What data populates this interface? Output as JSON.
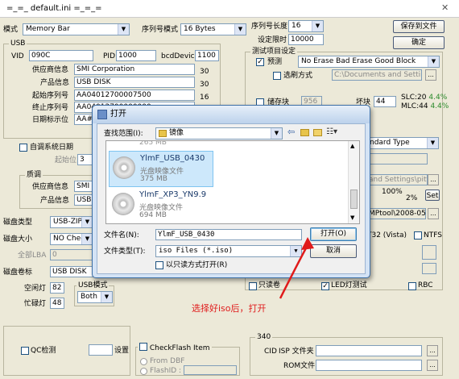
{
  "window": {
    "title": "=_=_   default.ini   =_=_=",
    "close_glyph": "✕"
  },
  "mode": {
    "label": "模式",
    "value": "Memory Bar"
  },
  "serial_mode": {
    "label": "序列号模式",
    "value": "16 Bytes"
  },
  "serial_length": {
    "label": "序列号长度",
    "value": "16"
  },
  "set_limit": {
    "label": "设定限时",
    "value": "10000"
  },
  "buttons": {
    "save": "保存到文件",
    "ok": "确定",
    "set": "Set"
  },
  "usb": {
    "group": "USB",
    "vid_label": "VID",
    "vid": "090C",
    "pid_label": "PID",
    "pid": "1000",
    "bcd_label": "bcdDevice",
    "bcd": "1100",
    "vendor_label": "供应商信息",
    "vendor": "SMI Corporation",
    "vendor_len": "30",
    "product_label": "产品信息",
    "product": "USB DISK",
    "product_len": "30",
    "start_sn_label": "起始序列号",
    "start_sn": "AA04012700007500",
    "start_sn_len": "16",
    "end_sn_label": "终止序列号",
    "end_sn": "AA04012700000000",
    "date_label": "日期标示位",
    "date": "AA##"
  },
  "auto_date": {
    "label": "自调系统日期",
    "start_label": "起始位",
    "start_value": "3"
  },
  "quality": {
    "group": "质调",
    "vendor_label": "供应商信息",
    "vendor": "SMI",
    "product_label": "产品信息",
    "product": "USB D"
  },
  "disk_type": {
    "label": "磁盘类型",
    "value": "USB-ZIP"
  },
  "disk_size": {
    "label": "磁盘大小",
    "value": "NO Check"
  },
  "all_lba": {
    "label": "全部LBA",
    "value": "0"
  },
  "disk_label": {
    "label": "磁盘卷标",
    "value": "USB DISK"
  },
  "idle_light": {
    "label": "空闲灯",
    "value": "82"
  },
  "busy_light": {
    "label": "忙碌灯",
    "value": "48"
  },
  "usb_mode": {
    "label": "USB模式",
    "value": "Both"
  },
  "test_group": {
    "title": "测试项目设定",
    "pre_label": "预测",
    "pre_value": "No Erase Bad Erase Good Block",
    "select_label": "选刷方式",
    "path": "C:\\Documents and Settings\\pit",
    "storage_label": "储存块",
    "storage_value": "956",
    "bad_label": "坏块",
    "bad_value": "44",
    "slc": "SLC:20",
    "slc_pct": "4.4%",
    "mlc": "MLC:44",
    "mlc_pct": "4.4%",
    "standard": "ndard Type",
    "settings_path": "and Settings\\pitt.c",
    "percent": "100%",
    "percent2": "2%",
    "mp_tool": "MPtool\\2008-05-2",
    "fat": "T32 (Vista)",
    "ntfs": "NTFS",
    "readonly": "只读卷",
    "led": "LED灯测试",
    "rbc": "RBC"
  },
  "qc": {
    "label": "QC检测",
    "count_label": "设置"
  },
  "checkflash": {
    "label": "CheckFlash Item",
    "from_dbf": "From DBF",
    "flash_id": "FlashID :"
  },
  "g340": {
    "title": "340",
    "cid_label": "CID",
    "isp_label": "ISP 文件夹",
    "rom_label": "ROM文件",
    "browse": "..."
  },
  "dialog": {
    "title": "打开",
    "look_in_label": "查找范围(I):",
    "look_in_value": "镜像",
    "partial_size": "265 MB",
    "files": [
      {
        "name": "YlmF_USB_0430",
        "type": "光盘映像文件",
        "size": "375 MB"
      },
      {
        "name": "YlmF_XP3_YN9.9",
        "type": "光盘映像文件",
        "size": "694 MB"
      }
    ],
    "filename_label": "文件名(N):",
    "filename_value": "YlmF_USB_0430",
    "filetype_label": "文件类型(T):",
    "filetype_value": "iso Files (*.iso)",
    "readonly_label": "以只读方式打开(R)",
    "open_button": "打开(O)",
    "cancel_button": "取消"
  },
  "annotation": "选择好iso后，打开",
  "colors": {
    "accent_green": "#2a8a2a",
    "annotation_red": "#e01b1b"
  }
}
